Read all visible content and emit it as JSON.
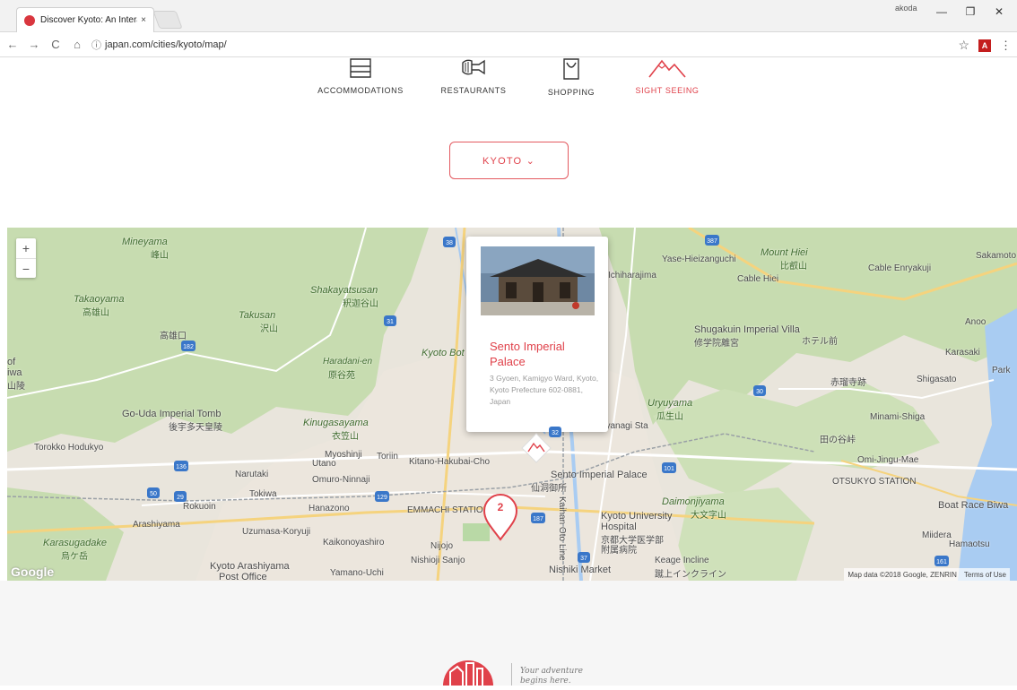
{
  "browser": {
    "tab_title": "Discover Kyoto: An Intera",
    "tab_close": "×",
    "profile_name": "akoda",
    "url": "japan.com/cities/kyoto/map/",
    "win_minimize": "—",
    "win_restore": "❐",
    "win_close": "✕"
  },
  "nav": {
    "back": "←",
    "forward": "→",
    "reload": "C",
    "home": "⌂",
    "info": "ⓘ",
    "star": "☆",
    "pdf": "A",
    "menu": "⋮"
  },
  "categories": [
    {
      "label": "ACCOMMODATIONS",
      "icon": "bed-icon",
      "active": false
    },
    {
      "label": "RESTAURANTS",
      "icon": "restaurant-icon",
      "active": false
    },
    {
      "label": "SHOPPING",
      "icon": "shopping-bag-icon",
      "active": false
    },
    {
      "label": "SIGHT SEEING",
      "icon": "mountain-icon",
      "active": true
    }
  ],
  "city_selector": {
    "label": "KYOTO ⌄"
  },
  "map": {
    "zoom_in": "+",
    "zoom_out": "−",
    "google": "Google",
    "attribution": "Map data ©2018 Google, ZENRIN",
    "terms": "Terms of Use",
    "labels": [
      "Mineyama",
      "峰山",
      "Takaoyama",
      "高雄山",
      "Shakayatsusan",
      "釈迦谷山",
      "Takusan",
      "沢山",
      "Haradani-en",
      "原谷苑",
      "Kyoto Bot",
      "Go-Uda Imperial Tomb",
      "後宇多天皇陵",
      "Kinugasayama",
      "衣笠山",
      "Myoshinji",
      "Utano",
      "Narutaki",
      "Omuro-Ninnaji",
      "Tokiwa",
      "Hanazono",
      "Rokuoin",
      "Arashiyama",
      "Uzumasa-Koryuji",
      "Kaikonoyashiro",
      "Karasugadake",
      "烏ケ岳",
      "Kyoto Arashiyama",
      "Post Office",
      "Yamano-Uchi",
      "EMMACHI STATION",
      "Nijojo",
      "Nishioji Sanjo",
      "Kitano-Hakubai-Cho",
      "Toriin",
      "Sento Imperial Palace",
      "仙洞御所",
      "Kyoto University",
      "Hospital",
      "京都大学医学部",
      "附属病院",
      "Nishiki Market",
      "Keage Incline",
      "蹴上インクライン",
      "Daimonjiyama",
      "大文字山",
      "Uryuyama",
      "瓜生山",
      "Shugakuin Imperial Villa",
      "修学院離宮",
      "Mount Hiei",
      "比叡山",
      "Sakamoto",
      "Cable Enryakuji",
      "Cable Hiei",
      "Anoo",
      "Karasaki",
      "Park",
      "Minami-Shiga",
      "Omi-Jingu-Mae",
      "OTSUKYO STATION",
      "Boat Race Biwa",
      "Miidera",
      "Hamaotsu",
      "Demachiyanagi Sta",
      "Kaihan Oto Line",
      "Yase-Hieizanguchi",
      "Ichiharajima",
      "赤瑠寺跡",
      "ホテル前",
      "田の谷峠",
      "Shigasato",
      "高雄口",
      "Torokko Hodukyo",
      "of",
      "iwa",
      "山陵"
    ],
    "popup": {
      "title": "Sento Imperial Palace",
      "address": "3 Gyoen, Kamigyo Ward, Kyoto, Kyoto Prefecture 602-0881, Japan"
    },
    "cluster_count": "2",
    "route_shields": [
      "38",
      "31",
      "182",
      "136",
      "29",
      "50",
      "129",
      "187",
      "32",
      "101",
      "37",
      "30",
      "387",
      "161"
    ]
  },
  "footer": {
    "tagline_line1": "Your adventure",
    "tagline_line2": "begins here."
  },
  "colors": {
    "accent": "#e0414a",
    "map_green": "#c8dbb1",
    "map_urban": "#ece7df",
    "water": "#aacbf0"
  }
}
